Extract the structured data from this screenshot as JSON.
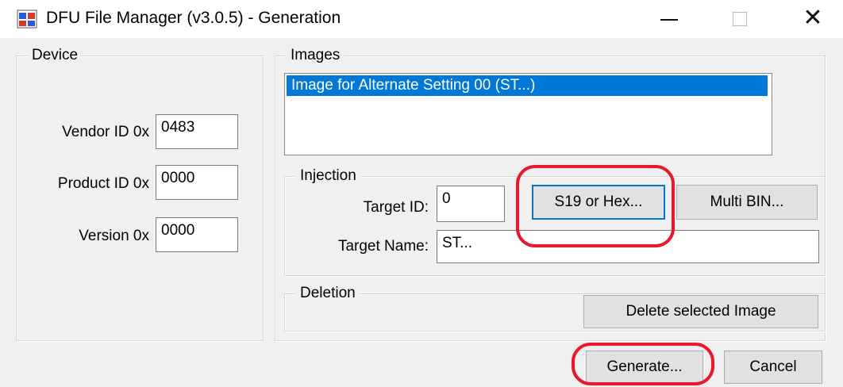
{
  "window": {
    "title": "DFU File Manager (v3.0.5) - Generation",
    "close_glyph": "✕"
  },
  "device": {
    "legend": "Device",
    "vendor_label": "Vendor ID 0x",
    "vendor_value": "0483",
    "product_label": "Product ID 0x",
    "product_value": "0000",
    "version_label": "Version 0x",
    "version_value": "0000"
  },
  "images": {
    "legend": "Images",
    "items": [
      "Image for Alternate Setting 00  (ST...)"
    ]
  },
  "injection": {
    "legend": "Injection",
    "target_id_label": "Target ID:",
    "target_id_value": "0",
    "s19_button": "S19 or Hex...",
    "multibin_button": "Multi BIN...",
    "target_name_label": "Target Name:",
    "target_name_value": "ST..."
  },
  "deletion": {
    "legend": "Deletion",
    "delete_button": "Delete selected Image"
  },
  "footer": {
    "generate_button": "Generate...",
    "cancel_button": "Cancel"
  },
  "colors": {
    "selection": "#0078d7",
    "highlight": "#e8192c"
  }
}
